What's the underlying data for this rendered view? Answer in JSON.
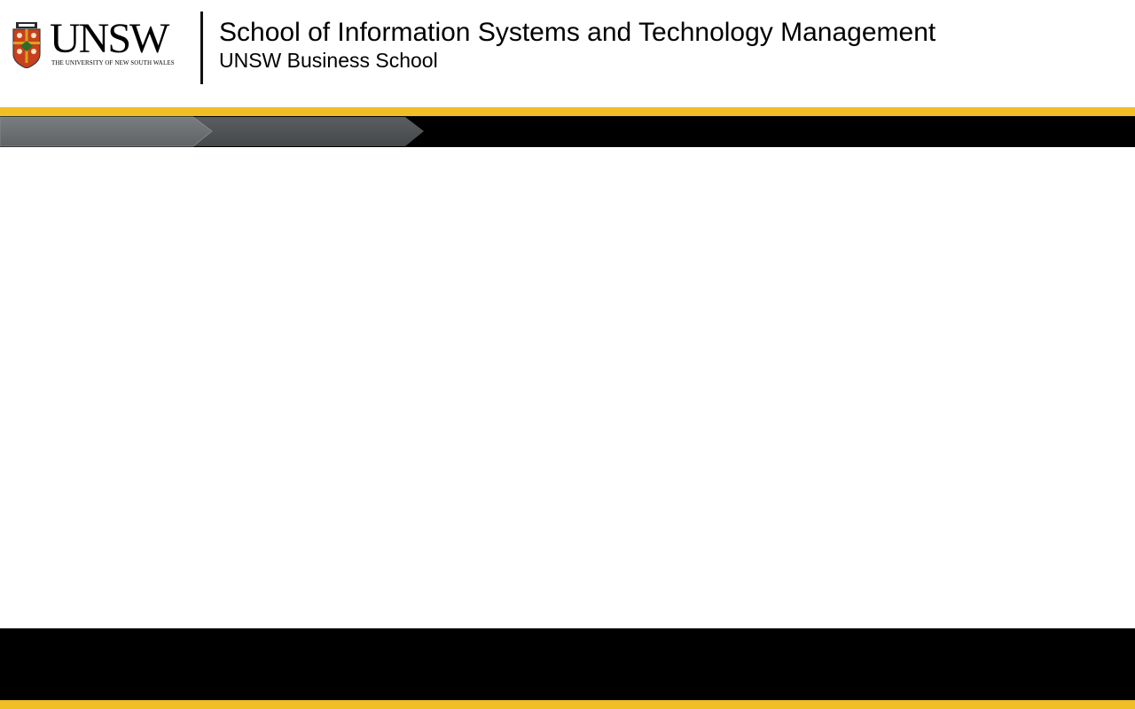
{
  "header": {
    "logo": {
      "wordmark": "UNSW",
      "university_name": "THE UNIVERSITY OF NEW SOUTH WALES",
      "crest_icon": "unsw-crest-icon"
    },
    "title": "School of Information Systems and Technology Management",
    "subtitle": "UNSW Business School"
  },
  "colors": {
    "accent_gold": "#f0be25",
    "bar_black": "#000000",
    "nav_segment_1": "#6d7073",
    "nav_segment_2": "#4f5254",
    "crest_red": "#c8401e",
    "crest_gold": "#d9a21b"
  },
  "nav": {
    "segments": [
      "",
      ""
    ]
  }
}
